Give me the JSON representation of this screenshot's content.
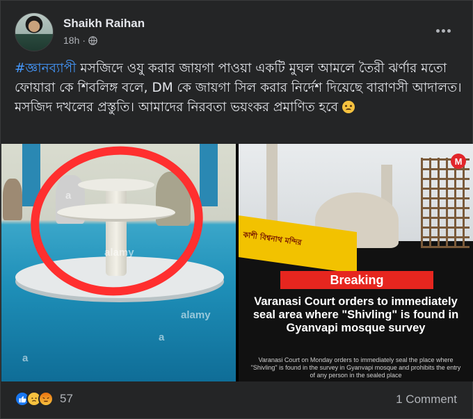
{
  "post": {
    "author": "Shaikh Raihan",
    "time": "18h",
    "audience_icon": "globe-icon",
    "more_icon": "more-options-icon",
    "hashtag": "#জ্ঞানব্যাপী",
    "text": " মসজিদে ওযু করার জায়গা পাওয়া একটি মুঘল আমলে তৈরী ঝর্ণার মতো ফোয়ারা কে শিবলিঙ্গ বলে, DM কে জায়গা সিল করার নির্দেশ দিয়েছে বারাণসী আদালত। মসজিদ দখলের প্রস্তুতি। আমাদের নিরবতা ভয়ংকর প্রমাণিত হবে ",
    "emoji": "sad-face-emoji"
  },
  "media": {
    "left_image": {
      "watermarks": [
        "a",
        "alamy",
        "a",
        "alamy",
        "a"
      ]
    },
    "right_image": {
      "logo": "M",
      "banner_text": "কাশী বিশ্বনাথ মন্দির",
      "breaking": "Breaking",
      "headline": "Varanasi Court orders to immediately seal area where \"Shivling\" is found in Gyanvapi mosque survey",
      "subline": "Varanasi Court on Monday orders to immediately seal the place where \"Shivling\" is found in the survey in Gyanvapi mosque and prohibits the entry of any person in the sealed place"
    }
  },
  "footer": {
    "reaction_icons": [
      "like-icon",
      "sad-icon",
      "angry-icon"
    ],
    "reaction_count": "57",
    "comments_label": "1 Comment"
  },
  "colors": {
    "background": "#242526",
    "text": "#e4e6eb",
    "secondary": "#b0b3b8",
    "hashtag": "#4599ff",
    "breaking": "#e6261f"
  }
}
